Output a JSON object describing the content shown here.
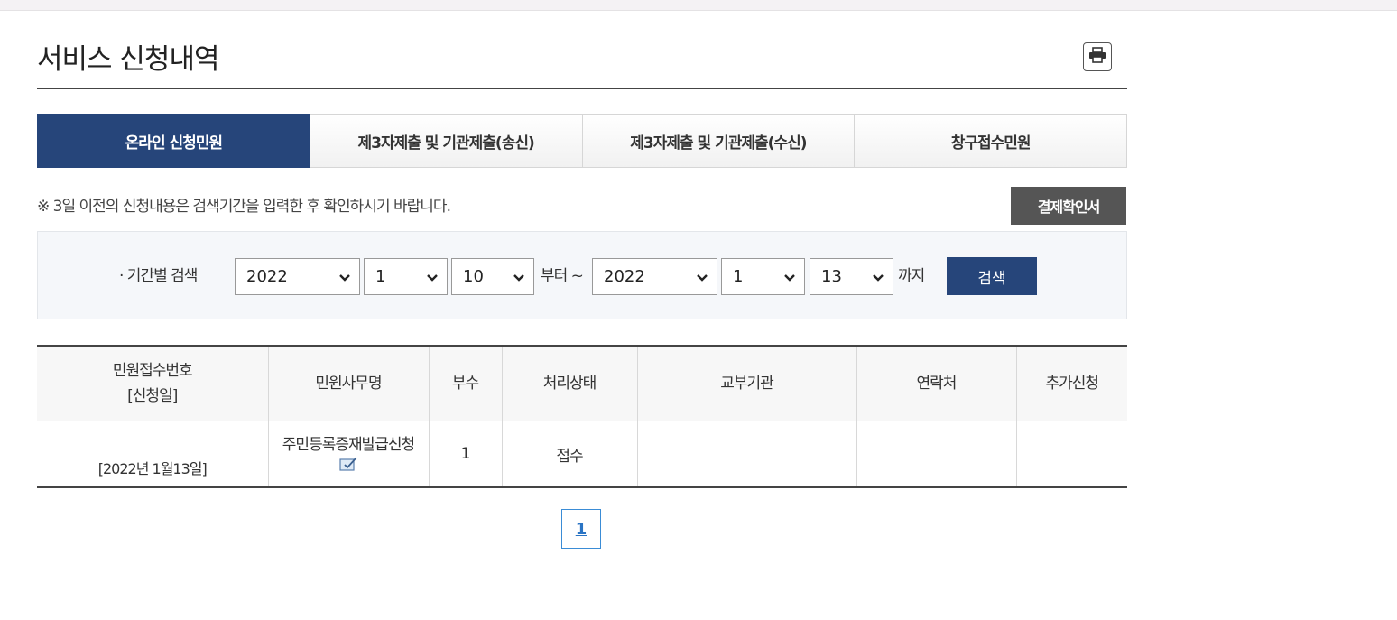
{
  "page": {
    "title": "서비스 신청내역"
  },
  "tabs": [
    {
      "label": "온라인 신청민원",
      "active": true
    },
    {
      "label": "제3자제출 및 기관제출(송신)",
      "active": false
    },
    {
      "label": "제3자제출 및 기관제출(수신)",
      "active": false
    },
    {
      "label": "창구접수민원",
      "active": false
    }
  ],
  "notice": "※ 3일 이전의 신청내용은 검색기간을 입력한 후 확인하시기 바랍니다.",
  "receipt_button": "결제확인서",
  "search": {
    "label": "· 기간별 검색",
    "from": {
      "year": "2022",
      "month": "1",
      "day": "10"
    },
    "from_suffix": "부터 ~",
    "to": {
      "year": "2022",
      "month": "1",
      "day": "13"
    },
    "to_suffix": "까지",
    "button": "검색"
  },
  "table": {
    "headers": {
      "number_line1": "민원접수번호",
      "number_line2": "[신청일]",
      "service": "민원사무명",
      "copies": "부수",
      "status": "처리상태",
      "issuer": "교부기관",
      "contact": "연락처",
      "extra": "추가신청"
    },
    "rows": [
      {
        "date": "[2022년 1월13일]",
        "service": "주민등록증재발급신청",
        "copies": "1",
        "status": "접수",
        "issuer": "",
        "contact": "",
        "extra": ""
      }
    ]
  },
  "pagination": {
    "current": "1"
  },
  "colors": {
    "primary": "#26457a",
    "receipt_button": "#555555",
    "pager_border": "#3a8cd6"
  }
}
